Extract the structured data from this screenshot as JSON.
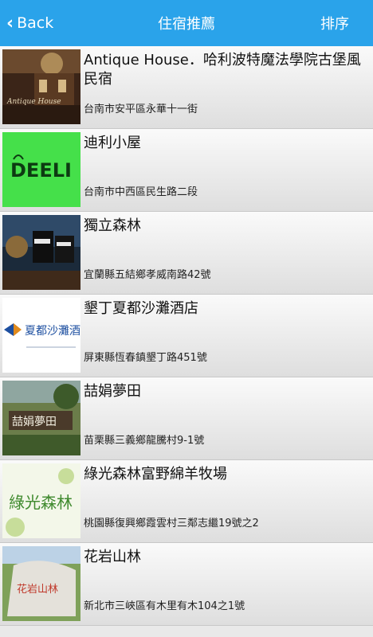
{
  "topbar": {
    "back_label": "Back",
    "title": "住宿推薦",
    "sort_label": "排序"
  },
  "items": [
    {
      "name": "Antique House．哈利波特魔法學院古堡風民宿",
      "address": "台南市安平區永華十一街",
      "thumb_text": "Antique House"
    },
    {
      "name": "迪利小屋",
      "address": "台南市中西區民生路二段",
      "thumb_text": "DEELI"
    },
    {
      "name": "獨立森林",
      "address": "宜蘭縣五結鄉孝威南路42號",
      "thumb_text": ""
    },
    {
      "name": "墾丁夏都沙灘酒店",
      "address": "屏東縣恆春鎮墾丁路451號",
      "thumb_text": "夏都沙灘酒店"
    },
    {
      "name": "喆娟夢田",
      "address": "苗栗縣三義鄉龍騰村9-1號",
      "thumb_text": "喆娟夢田"
    },
    {
      "name": "綠光森林富野綿羊牧場",
      "address": "桃園縣復興鄉霞雲村三鄰志繼19號之2",
      "thumb_text": "綠光森林"
    },
    {
      "name": "花岩山林",
      "address": "新北市三峽區有木里有木104之1號",
      "thumb_text": "花岩山林"
    }
  ],
  "colors": {
    "topbar_bg": "#2aa3ea",
    "list_bg": "#e9e9e9"
  }
}
